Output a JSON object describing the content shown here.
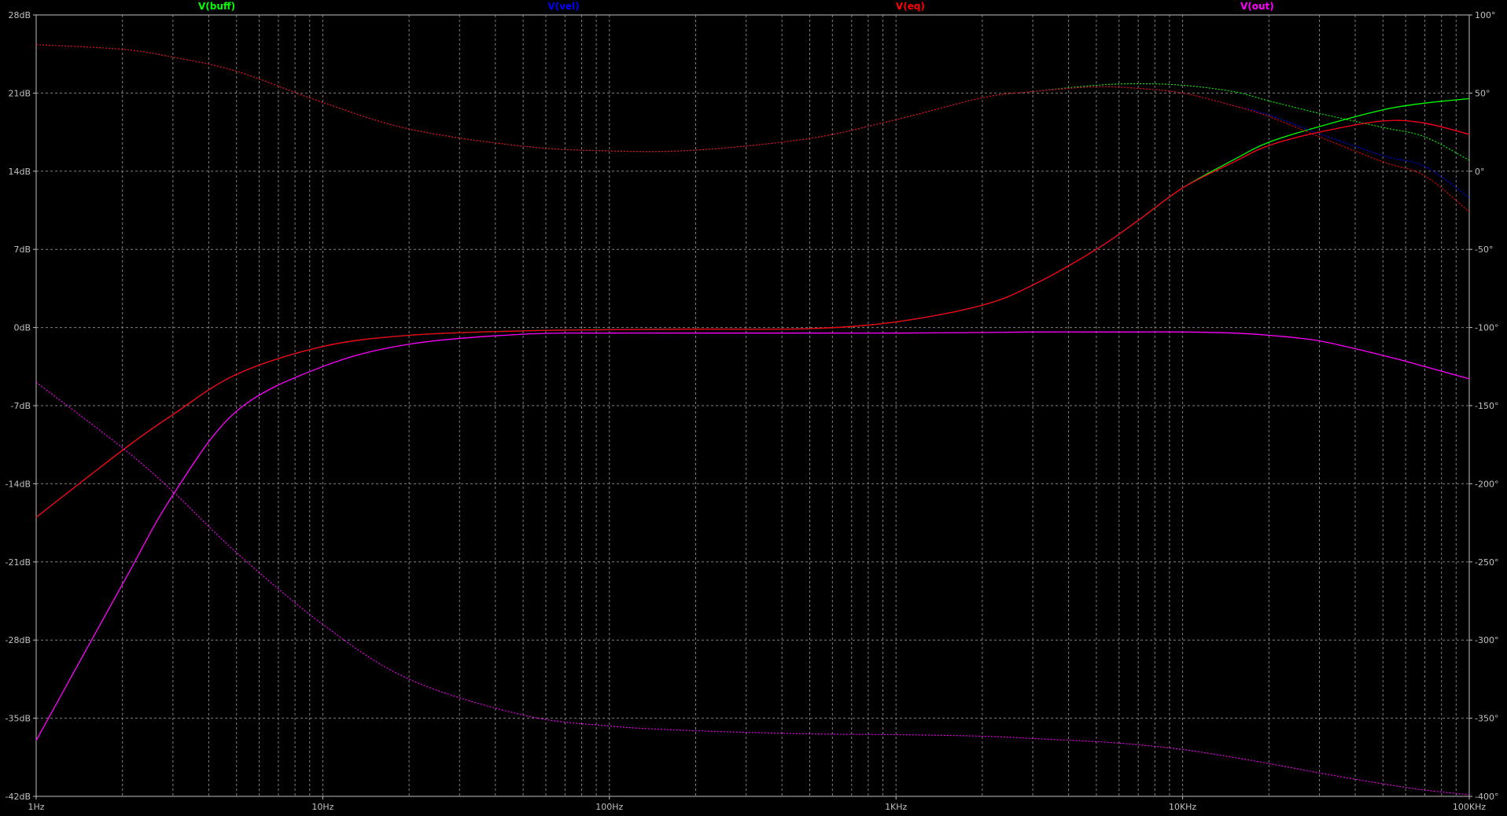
{
  "chart_data": {
    "type": "line",
    "x_scale": "log",
    "xlim": [
      1,
      100000
    ],
    "x_ticks": [
      {
        "value": 1,
        "label": "1Hz"
      },
      {
        "value": 10,
        "label": "10Hz"
      },
      {
        "value": 100,
        "label": "100Hz"
      },
      {
        "value": 1000,
        "label": "1KHz"
      },
      {
        "value": 10000,
        "label": "10KHz"
      },
      {
        "value": 100000,
        "label": "100KHz"
      }
    ],
    "y_left": {
      "unit": "dB",
      "ylim": [
        -42,
        28
      ],
      "ticks": [
        {
          "value": 28,
          "label": "28dB"
        },
        {
          "value": 21,
          "label": "21dB"
        },
        {
          "value": 14,
          "label": "14dB"
        },
        {
          "value": 7,
          "label": "7dB"
        },
        {
          "value": 0,
          "label": "0dB"
        },
        {
          "value": -7,
          "label": "-7dB"
        },
        {
          "value": -14,
          "label": "-14dB"
        },
        {
          "value": -21,
          "label": "-21dB"
        },
        {
          "value": -28,
          "label": "-28dB"
        },
        {
          "value": -35,
          "label": "-35dB"
        },
        {
          "value": -42,
          "label": "-42dB"
        }
      ]
    },
    "y_right": {
      "unit": "degrees",
      "ylim": [
        -400,
        100
      ],
      "ticks": [
        {
          "value": 100,
          "label": "100°"
        },
        {
          "value": 50,
          "label": "50°"
        },
        {
          "value": 0,
          "label": "0°"
        },
        {
          "value": -50,
          "label": "-50°"
        },
        {
          "value": -100,
          "label": "-100°"
        },
        {
          "value": -150,
          "label": "-150°"
        },
        {
          "value": -200,
          "label": "-200°"
        },
        {
          "value": -250,
          "label": "-250°"
        },
        {
          "value": -300,
          "label": "-300°"
        },
        {
          "value": -350,
          "label": "-350°"
        },
        {
          "value": -400,
          "label": "-400°"
        }
      ]
    },
    "grid": true,
    "legend_position": "top",
    "series": [
      {
        "name": "V(buff)",
        "color": "#00ff00",
        "magnitude": {
          "x": [
            1,
            2,
            3,
            5,
            10,
            20,
            50,
            100,
            200,
            500,
            1000,
            2000,
            3000,
            5000,
            7000,
            10000,
            15000,
            20000,
            30000,
            50000,
            70000,
            100000
          ],
          "y": [
            -17,
            -11,
            -7.8,
            -4.2,
            -1.7,
            -0.7,
            -0.3,
            -0.2,
            -0.15,
            -0.1,
            0.5,
            2,
            3.8,
            7,
            9.6,
            12.5,
            15,
            16.6,
            18,
            19.5,
            20.1,
            20.5
          ]
        },
        "phase": {
          "x": [
            1,
            2,
            3,
            5,
            10,
            20,
            50,
            100,
            200,
            500,
            1000,
            2000,
            3000,
            5000,
            7000,
            10000,
            15000,
            20000,
            30000,
            50000,
            70000,
            100000
          ],
          "y": [
            81,
            78,
            73,
            64,
            44,
            27,
            16,
            13,
            13.5,
            21,
            33,
            47,
            51,
            55,
            56,
            55,
            51,
            45,
            37,
            28,
            22,
            7
          ]
        }
      },
      {
        "name": "V(vel)",
        "color": "#0000ff",
        "magnitude": {
          "x": [
            1,
            2,
            3,
            5,
            10,
            20,
            50,
            100,
            200,
            500,
            1000,
            2000,
            3000,
            5000,
            7000,
            10000,
            15000,
            20000,
            30000,
            50000,
            70000,
            100000
          ],
          "y": [
            -17,
            -11,
            -7.8,
            -4.2,
            -1.7,
            -0.7,
            -0.3,
            -0.2,
            -0.15,
            -0.1,
            0.5,
            2,
            3.8,
            7,
            9.6,
            12.5,
            14.8,
            16.3,
            17.5,
            18.5,
            18.3,
            17.3
          ]
        },
        "phase": {
          "x": [
            1,
            2,
            3,
            5,
            10,
            20,
            50,
            100,
            200,
            500,
            1000,
            2000,
            3000,
            5000,
            7000,
            10000,
            15000,
            20000,
            30000,
            50000,
            70000,
            100000
          ],
          "y": [
            81,
            78,
            73,
            64,
            44,
            27,
            16,
            13,
            13.5,
            21,
            33,
            47,
            51,
            54,
            53,
            50,
            42,
            36,
            24,
            10,
            3,
            -17
          ]
        }
      },
      {
        "name": "V(eq)",
        "color": "#ff0000",
        "magnitude": {
          "x": [
            1,
            2,
            3,
            5,
            10,
            20,
            50,
            100,
            200,
            500,
            1000,
            2000,
            3000,
            5000,
            7000,
            10000,
            15000,
            20000,
            30000,
            50000,
            70000,
            100000
          ],
          "y": [
            -17,
            -11,
            -7.8,
            -4.2,
            -1.7,
            -0.7,
            -0.3,
            -0.2,
            -0.15,
            -0.1,
            0.5,
            2,
            3.8,
            7,
            9.6,
            12.5,
            14.8,
            16.3,
            17.5,
            18.5,
            18.3,
            17.3
          ]
        },
        "phase": {
          "x": [
            1,
            2,
            3,
            5,
            10,
            20,
            50,
            100,
            200,
            500,
            1000,
            2000,
            3000,
            5000,
            7000,
            10000,
            15000,
            20000,
            30000,
            50000,
            70000,
            100000
          ],
          "y": [
            81,
            78,
            73,
            64,
            44,
            27,
            16,
            13,
            13.5,
            21,
            33,
            47,
            51,
            54,
            53,
            50,
            42,
            35,
            22,
            6,
            -3,
            -26
          ]
        }
      },
      {
        "name": "V(out)",
        "color": "#ff00ff",
        "magnitude": {
          "x": [
            1,
            2,
            3,
            5,
            10,
            20,
            50,
            100,
            200,
            500,
            1000,
            2000,
            3000,
            5000,
            7000,
            10000,
            15000,
            20000,
            30000,
            50000,
            70000,
            100000
          ],
          "y": [
            -37,
            -23,
            -15,
            -7.5,
            -3.5,
            -1.5,
            -0.6,
            -0.5,
            -0.5,
            -0.5,
            -0.5,
            -0.45,
            -0.4,
            -0.4,
            -0.4,
            -0.4,
            -0.5,
            -0.7,
            -1.2,
            -2.5,
            -3.5,
            -4.6
          ]
        },
        "phase": {
          "x": [
            1,
            2,
            3,
            5,
            10,
            20,
            50,
            100,
            200,
            500,
            1000,
            2000,
            3000,
            5000,
            7000,
            10000,
            15000,
            20000,
            30000,
            50000,
            70000,
            100000
          ],
          "y": [
            -135,
            -177,
            -205,
            -244,
            -290,
            -325,
            -348,
            -355,
            -358,
            -360,
            -360.5,
            -361.5,
            -363,
            -365,
            -367,
            -370,
            -375,
            -379,
            -385,
            -392,
            -396,
            -399
          ]
        }
      }
    ]
  }
}
